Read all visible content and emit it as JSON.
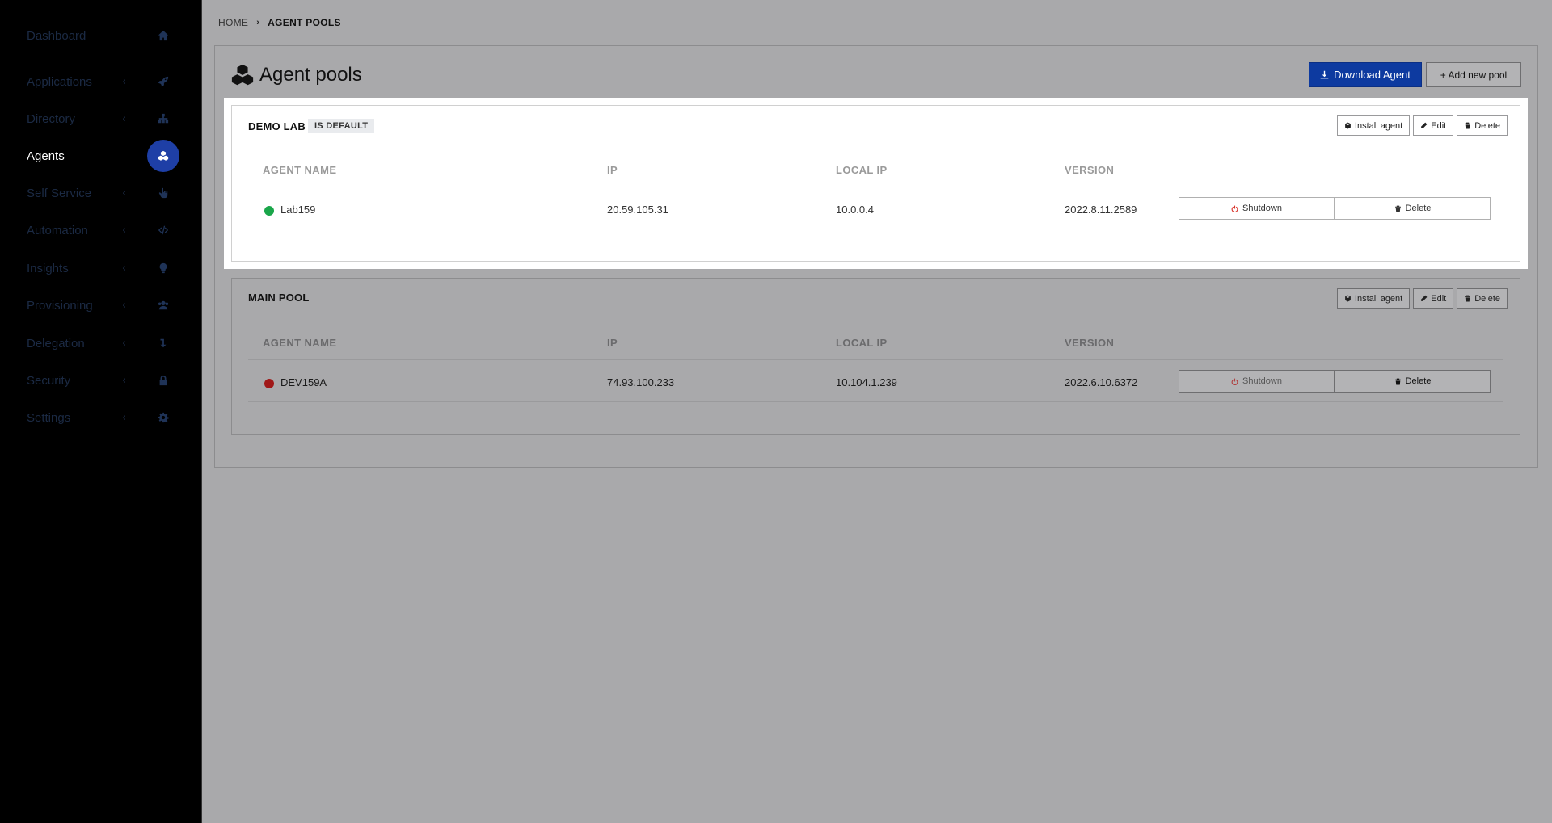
{
  "sidebar": {
    "items": [
      {
        "label": "Dashboard",
        "icon": "home-icon",
        "chevron": ""
      },
      {
        "label": "Applications",
        "icon": "rocket-icon",
        "chevron": "‹"
      },
      {
        "label": "Directory",
        "icon": "sitemap-icon",
        "chevron": "‹"
      },
      {
        "label": "Agents",
        "icon": "cubes-icon",
        "chevron": "",
        "active": true
      },
      {
        "label": "Self Service",
        "icon": "hand-pointer-icon",
        "chevron": "‹"
      },
      {
        "label": "Automation",
        "icon": "code-icon",
        "chevron": "‹"
      },
      {
        "label": "Insights",
        "icon": "lightbulb-icon",
        "chevron": "‹"
      },
      {
        "label": "Provisioning",
        "icon": "users-icon",
        "chevron": "‹"
      },
      {
        "label": "Delegation",
        "icon": "level-down-icon",
        "chevron": "‹"
      },
      {
        "label": "Security",
        "icon": "lock-icon",
        "chevron": "‹"
      },
      {
        "label": "Settings",
        "icon": "gear-icon",
        "chevron": "‹"
      }
    ]
  },
  "breadcrumb": {
    "home": "HOME",
    "separator": "›",
    "current": "AGENT POOLS"
  },
  "page": {
    "title": "Agent pools",
    "download_button": "Download Agent",
    "add_pool_button": "+ Add new pool"
  },
  "columns": {
    "name": "AGENT NAME",
    "ip": "IP",
    "local_ip": "LOCAL IP",
    "version": "VERSION"
  },
  "pools": [
    {
      "name": "DEMO LAB",
      "badge": "IS DEFAULT",
      "actions": {
        "install": "Install agent",
        "edit": "Edit",
        "delete": "Delete"
      },
      "agents": [
        {
          "name": "Lab159",
          "ip": "20.59.105.31",
          "local_ip": "10.0.0.4",
          "version": "2022.8.11.2589",
          "status_color": "#1aa64a",
          "shutdown": "Shutdown",
          "delete": "Delete"
        }
      ]
    },
    {
      "name": "MAIN POOL",
      "badge": "",
      "actions": {
        "install": "Install agent",
        "edit": "Edit",
        "delete": "Delete"
      },
      "agents": [
        {
          "name": "DEV159A",
          "ip": "74.93.100.233",
          "local_ip": "10.104.1.239",
          "version": "2022.6.10.6372",
          "status_color": "#a01818",
          "shutdown": "Shutdown",
          "delete": "Delete"
        }
      ]
    }
  ],
  "colors": {
    "accent": "#0d3aa0",
    "sidebar_active": "#1e3fa6",
    "online": "#1aa64a",
    "offline": "#a01818",
    "shutdown_icon": "#d9342b"
  }
}
